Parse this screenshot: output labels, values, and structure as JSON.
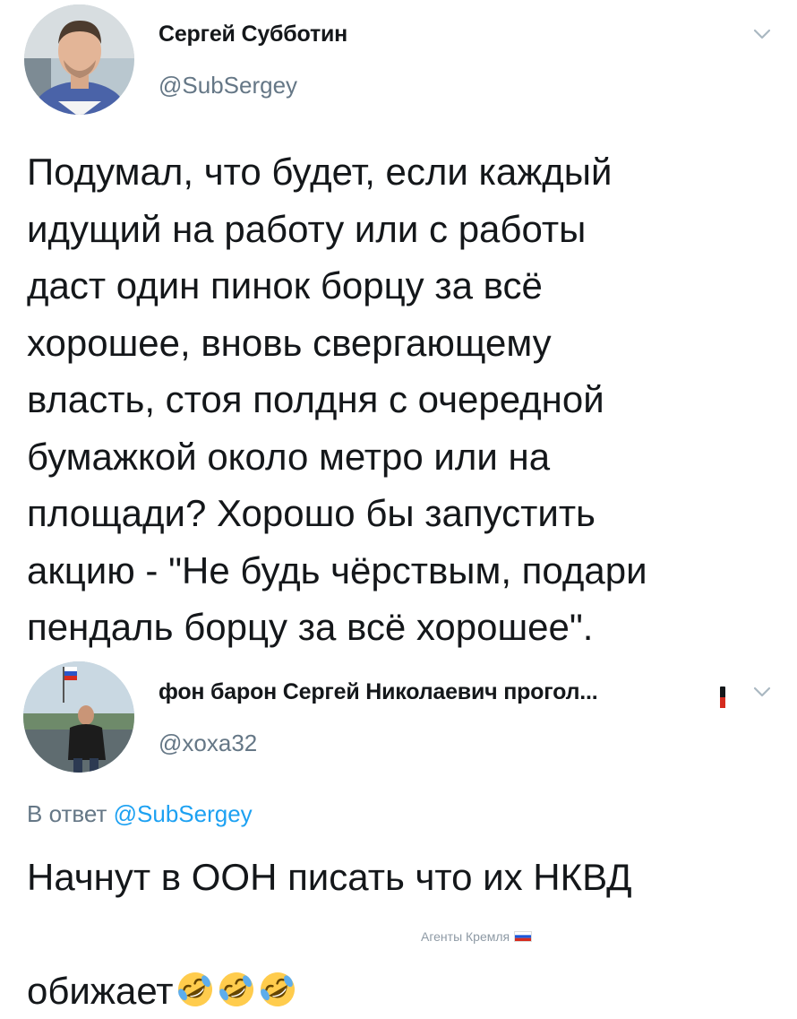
{
  "tweet_main": {
    "author_name": "Сергей Субботин",
    "author_handle": "@SubSergey",
    "text": "Подумал, что будет, если каждый\nидущий на работу или с работы\nдаст один пинок борцу за всё\nхорошее, вновь свергающему\nвласть, стоя полдня с очередной\nбумажкой около метро или на\nплощади? Хорошо бы запустить\nакцию - \"Не будь чёрствым, подари\nпендаль борцу за всё хорошее\"."
  },
  "tweet_reply": {
    "author_name": "фон барон Сергей Николаевич прогол...",
    "author_handle": "@xoxa32",
    "reply_prefix": "В ответ",
    "reply_mention": "@SubSergey",
    "line1": "Начнут в ООН писать что их НКВД",
    "line2": "обижает",
    "emoji": [
      "rolling-on-floor-laughing",
      "rolling-on-floor-laughing",
      "rolling-on-floor-laughing"
    ]
  },
  "watermark": {
    "text": "Агенты Кремля",
    "flag": "russia-flag"
  },
  "colors": {
    "text": "#14171a",
    "secondary": "#657786",
    "link": "#1da1f2",
    "emoji_face": "#ffcc4d",
    "tears": "#5dadec"
  },
  "icons": {
    "more_menu": "chevron-down-icon"
  }
}
